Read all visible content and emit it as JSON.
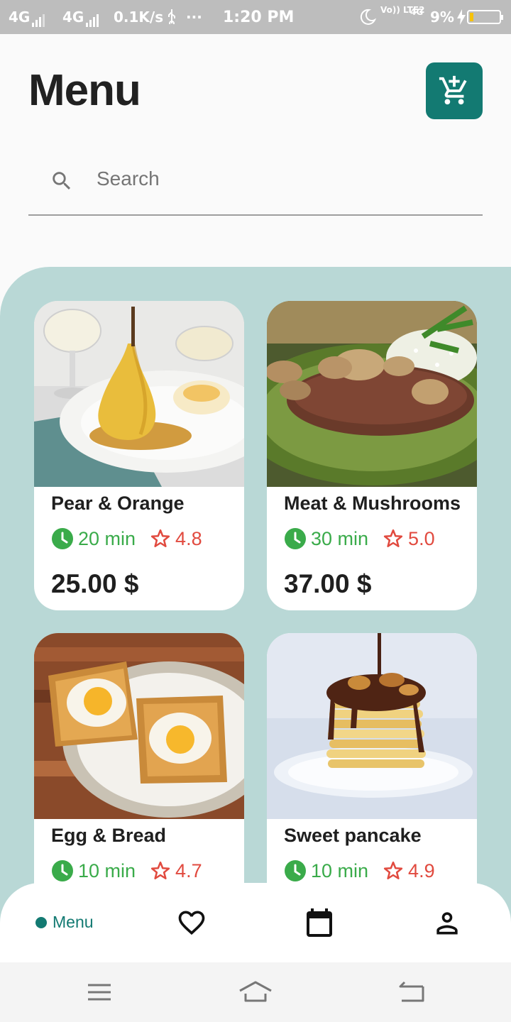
{
  "status_bar": {
    "network1": "4G",
    "network2": "4G",
    "speed": "0.1K/s",
    "usb_icon": "usb-icon",
    "more": "···",
    "time": "1:20 PM",
    "volte": "Vo)) LTE2",
    "network3": "4G",
    "battery": "9%"
  },
  "header": {
    "title": "Menu",
    "cart_icon": "cart-plus-icon",
    "accent_color": "#137a72"
  },
  "search": {
    "placeholder": "Search",
    "icon": "search-icon"
  },
  "panel_color": "#b9d8d6",
  "dishes": [
    {
      "title": "Pear & Orange",
      "time": "20 min",
      "rating": "4.8",
      "price": "25.00 $",
      "image": "poached-pear-photo"
    },
    {
      "title": "Meat & Mushrooms",
      "time": "30 min",
      "rating": "5.0",
      "price": "37.00 $",
      "image": "steak-mushrooms-photo"
    },
    {
      "title": "Egg & Bread",
      "time": "10 min",
      "rating": "4.7",
      "price": "",
      "image": "egg-toast-photo"
    },
    {
      "title": "Sweet pancake",
      "time": "10 min",
      "rating": "4.9",
      "price": "",
      "image": "pancake-stack-photo"
    }
  ],
  "bottom_nav": {
    "items": [
      {
        "label": "Menu",
        "icon": "dot-icon",
        "active": true
      },
      {
        "label": "",
        "icon": "heart-icon"
      },
      {
        "label": "",
        "icon": "calendar-icon"
      },
      {
        "label": "",
        "icon": "person-icon"
      }
    ]
  },
  "system_nav": [
    "menu-icon",
    "home-icon",
    "back-icon"
  ]
}
